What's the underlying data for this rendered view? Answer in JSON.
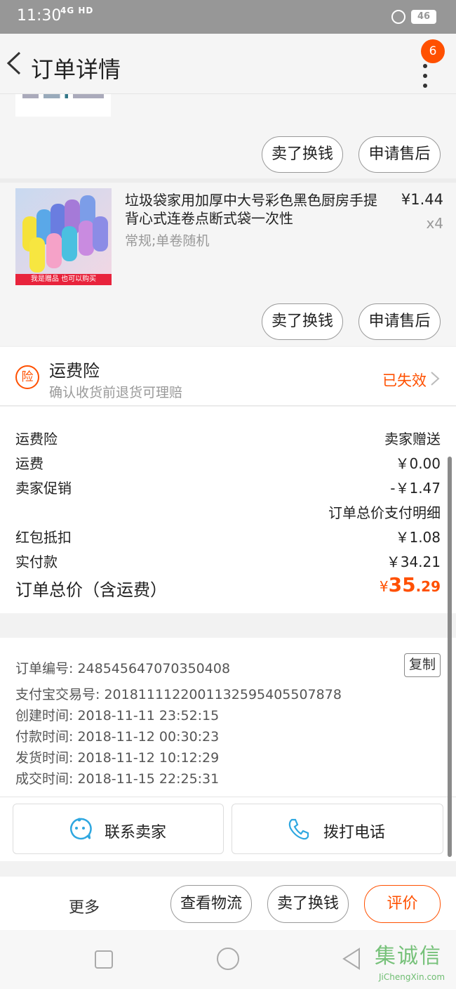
{
  "status_bar": {
    "time": "11:30",
    "network": "4G HD",
    "battery": "46"
  },
  "nav": {
    "title": "订单详情",
    "badge_count": "6"
  },
  "item_actions": {
    "sell_label": "卖了换钱",
    "aftersale_label": "申请售后"
  },
  "product": {
    "title": "垃圾袋家用加厚中大号彩色黑色厨房手提背心式连卷点断式袋一次性",
    "spec": "常规;单卷随机",
    "price": "¥1.44",
    "qty": "x4",
    "image_strip_text": "我是赠品 也可以购买"
  },
  "insurance": {
    "icon_text": "险",
    "title": "运费险",
    "subtitle": "确认收货前退货可理赔",
    "status": "已失效"
  },
  "summary": {
    "rows": [
      {
        "label": "运费险",
        "value": "卖家赠送"
      },
      {
        "label": "运费",
        "value": "￥0.00"
      },
      {
        "label": "卖家促销",
        "value": "-￥1.47"
      },
      {
        "label": "",
        "value": "订单总价支付明细"
      },
      {
        "label": "红包抵扣",
        "value": "￥1.08"
      },
      {
        "label": "实付款",
        "value": "￥34.21"
      }
    ],
    "total_label": "订单总价（含运费）",
    "total_currency": "¥",
    "total_int": "35",
    "total_dec": ".29"
  },
  "order_info": {
    "lines": [
      "订单编号: 248545647070350408",
      "支付宝交易号: 2018111122001132595405507878",
      "创建时间: 2018-11-11 23:52:15",
      "付款时间: 2018-11-12 00:30:23",
      "发货时间: 2018-11-12 10:12:29",
      "成交时间: 2018-11-15 22:25:31"
    ],
    "copy_label": "复制"
  },
  "contact": {
    "seller_label": "联系卖家",
    "phone_label": "拨打电话"
  },
  "bottom_bar": {
    "more_label": "更多",
    "logistics_label": "查看物流",
    "sell_label": "卖了换钱",
    "review_label": "评价"
  },
  "colors": {
    "accent": "#ff5000",
    "contact_icon": "#2ea7e0"
  },
  "watermark": {
    "text": "JiChengXin.com",
    "chars": "集诚信"
  }
}
